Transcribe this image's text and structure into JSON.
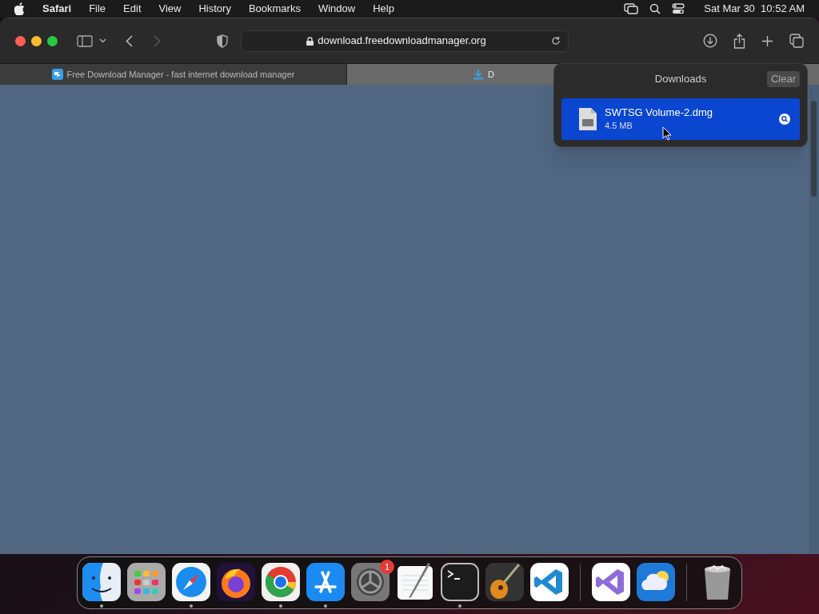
{
  "menu_bar": {
    "app": "Safari",
    "items": [
      "File",
      "Edit",
      "View",
      "History",
      "Bookmarks",
      "Window",
      "Help"
    ],
    "clock": "Sat Mar 30  10:52 AM"
  },
  "toolbar": {
    "address": "download.freedownloadmanager.org"
  },
  "tabs": [
    {
      "title": "Free Download Manager - fast internet download manager",
      "selected": false,
      "kind": "site"
    },
    {
      "title": "D",
      "selected": true,
      "kind": "download"
    }
  ],
  "downloads": {
    "title": "Downloads",
    "clear": "Clear",
    "items": [
      {
        "name": "SWTSG Volume-2.dmg",
        "size": "4.5 MB",
        "selected": true
      }
    ]
  },
  "dock": [
    {
      "kind": "finder",
      "running": true
    },
    {
      "kind": "launchpad",
      "running": false
    },
    {
      "kind": "safari",
      "running": true
    },
    {
      "kind": "firefox",
      "running": false
    },
    {
      "kind": "chrome",
      "running": true
    },
    {
      "kind": "appstore",
      "running": true
    },
    {
      "kind": "settings",
      "running": false,
      "badge": "1"
    },
    {
      "kind": "textedit",
      "running": false
    },
    {
      "kind": "terminal",
      "running": true
    },
    {
      "kind": "guitar",
      "running": false
    },
    {
      "kind": "vscode",
      "running": false
    },
    {
      "kind": "separator"
    },
    {
      "kind": "visualstudio",
      "running": false
    },
    {
      "kind": "weather",
      "running": false
    },
    {
      "kind": "separator"
    },
    {
      "kind": "trash",
      "running": false
    }
  ]
}
